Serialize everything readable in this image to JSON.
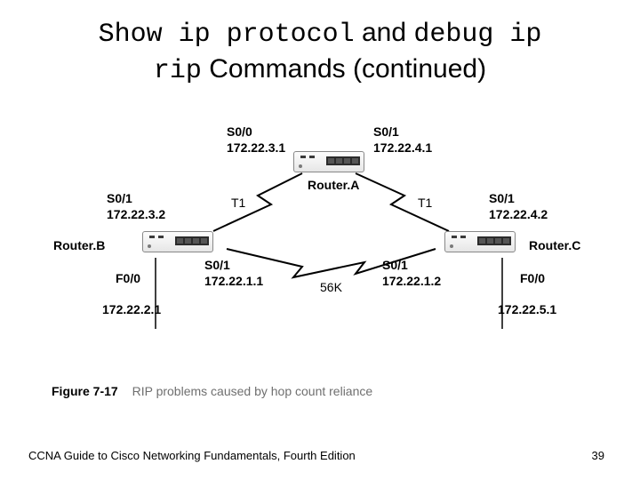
{
  "title": {
    "part1_mono": "Show ip protocol",
    "part2_sans": " and ",
    "part3_mono": "debug ip",
    "part4_mono": "rip",
    "part5_sans": " Commands (continued)"
  },
  "diagram": {
    "routerA": {
      "name": "Router.A",
      "if_left": {
        "port": "S0/0",
        "ip": "172.22.3.1"
      },
      "if_right": {
        "port": "S0/1",
        "ip": "172.22.4.1"
      }
    },
    "routerB": {
      "name": "Router.B",
      "if_top": {
        "port": "S0/1",
        "ip": "172.22.3.2"
      },
      "if_right": {
        "port": "S0/1",
        "ip": "172.22.1.1"
      },
      "if_lan": {
        "port": "F0/0",
        "ip": "172.22.2.1"
      }
    },
    "routerC": {
      "name": "Router.C",
      "if_top": {
        "port": "S0/1",
        "ip": "172.22.4.2"
      },
      "if_left": {
        "port": "S0/1",
        "ip": "172.22.1.2"
      },
      "if_lan": {
        "port": "F0/0",
        "ip": "172.22.5.1"
      }
    },
    "link_ab": "T1",
    "link_ac": "T1",
    "link_bc": "56K"
  },
  "caption": {
    "fig": "Figure 7-17",
    "text": "RIP problems caused by hop count reliance"
  },
  "footer": {
    "left": "CCNA Guide to Cisco Networking Fundamentals, Fourth Edition",
    "page": "39"
  }
}
